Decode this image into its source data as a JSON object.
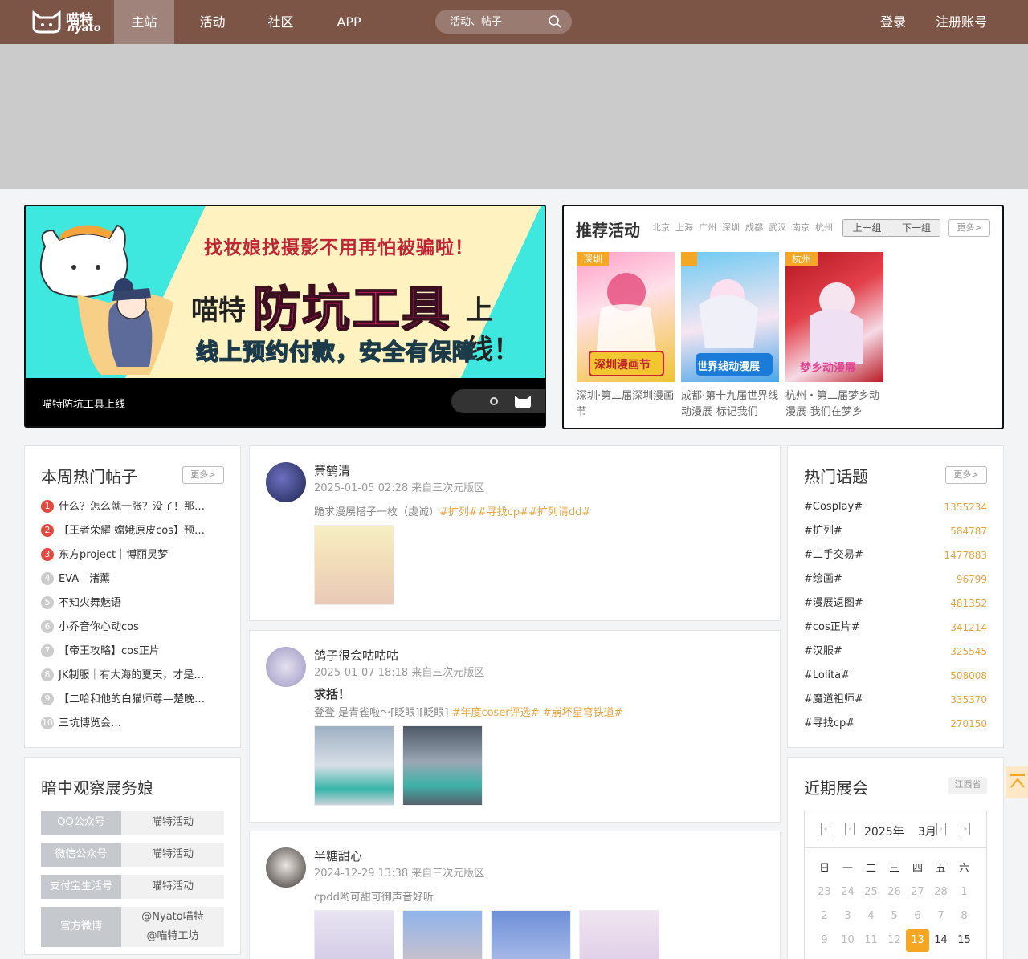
{
  "nav": {
    "logo_text": "喵特",
    "logo_sub": "nyato",
    "items": [
      "主站",
      "活动",
      "社区",
      "APP"
    ],
    "search_placeholder": "活动、帖子",
    "login": "登录",
    "register": "注册账号"
  },
  "carousel": {
    "headline": "找妆娘找摄影不用再怕被骗啦！",
    "brand": "喵特",
    "big": "防坑工具",
    "suffix": "上线！",
    "sub": "线上预约付款，安全有保障",
    "caption": "喵特防坑工具上线"
  },
  "recommend": {
    "title": "推荐活动",
    "cities": [
      "北京",
      "上海",
      "广州",
      "深圳",
      "成都",
      "武汉",
      "南京",
      "杭州"
    ],
    "prev": "上一组",
    "next": "下一组",
    "more": "更多>",
    "events": [
      {
        "tag": "深圳",
        "name": "深圳·第二届深圳漫画节",
        "poster_text": "深圳漫画节",
        "colors": [
          "#f0c430",
          "#e54a7c"
        ]
      },
      {
        "tag": "",
        "name": "成都·第十九届世界线动漫展-标记我们",
        "poster_text": "世界线动漫展",
        "colors": [
          "#64c6f0",
          "#f4d2e8"
        ]
      },
      {
        "tag": "杭州",
        "name": "杭州・第二届梦乡动漫展-我们在梦乡",
        "poster_text": "梦乡动漫展",
        "colors": [
          "#c3202a",
          "#f2d7e4"
        ]
      }
    ]
  },
  "hot_posts": {
    "title": "本周热门帖子",
    "more": "更多>",
    "items": [
      "什么？怎么就一张？没了！那…",
      "【王者荣耀 嫦娥原皮cos】预…",
      "东方project｜博丽灵梦",
      "EVA｜渚薰",
      "不知火舞魅语",
      "小乔音你心动cos",
      "【帝王攻略】cos正片",
      "JK制服｜有大海的夏天，才是…",
      "【二哈和他的白猫师尊—楚晚…",
      "三坑博览会…"
    ]
  },
  "observe": {
    "title": "暗中观察展务娘",
    "rows": [
      {
        "label": "QQ公众号",
        "value": "喵特活动"
      },
      {
        "label": "微信公众号",
        "value": "喵特活动"
      },
      {
        "label": "支付宝生活号",
        "value": "喵特活动"
      },
      {
        "label": "官方微博",
        "value": "@Nyato喵特",
        "value2": "@喵特工坊"
      }
    ]
  },
  "posts": [
    {
      "user": "萧鹤清",
      "meta": "2025-01-05 02:28 来自三次元版区",
      "title": "",
      "text": "跪求漫展搭子一枚（虔诚）",
      "tags": "#扩列##寻找cp##扩列请dd#",
      "images": 1
    },
    {
      "user": "鸽子很会咕咕咕",
      "meta": "2025-01-07 18:18 来自三次元版区",
      "title": "求括！",
      "text": "登登 是青雀啦～[眨眼][眨眼]",
      "tags": "#年度coser评选# #崩坏星穹铁道#",
      "images": 2
    },
    {
      "user": "半糖甜心",
      "meta": "2024-12-29 13:38 来自三次元版区",
      "title": "",
      "text": "cpdd哟可甜可御声音好听",
      "tags": "",
      "images": 4
    }
  ],
  "topics": {
    "title": "热门话题",
    "more": "更多>",
    "items": [
      {
        "name": "#Cosplay#",
        "count": "1355234"
      },
      {
        "name": "#扩列#",
        "count": "584787"
      },
      {
        "name": "#二手交易#",
        "count": "1477883"
      },
      {
        "name": "#绘画#",
        "count": "96799"
      },
      {
        "name": "#漫展返图#",
        "count": "481352"
      },
      {
        "name": "#cos正片#",
        "count": "341214"
      },
      {
        "name": "#汉服#",
        "count": "325545"
      },
      {
        "name": "#Lolita#",
        "count": "508008"
      },
      {
        "name": "#魔道祖师#",
        "count": "335370"
      },
      {
        "name": "#寻找cp#",
        "count": "270150"
      }
    ]
  },
  "calendar": {
    "title": "近期展会",
    "province": "江西省",
    "year": "2025年",
    "month": "3月",
    "weekdays": [
      "日",
      "一",
      "二",
      "三",
      "四",
      "五",
      "六"
    ],
    "rows": [
      [
        "23",
        "24",
        "25",
        "26",
        "27",
        "28",
        "1"
      ],
      [
        "2",
        "3",
        "4",
        "5",
        "6",
        "7",
        "8"
      ],
      [
        "9",
        "10",
        "11",
        "12",
        "13",
        "14",
        "15"
      ]
    ],
    "today": "13",
    "accent": "#f5a623"
  },
  "colors": {
    "nav_bg": "#7d5547",
    "tag": "#e8a33a",
    "rank_top": "#e5483f"
  }
}
